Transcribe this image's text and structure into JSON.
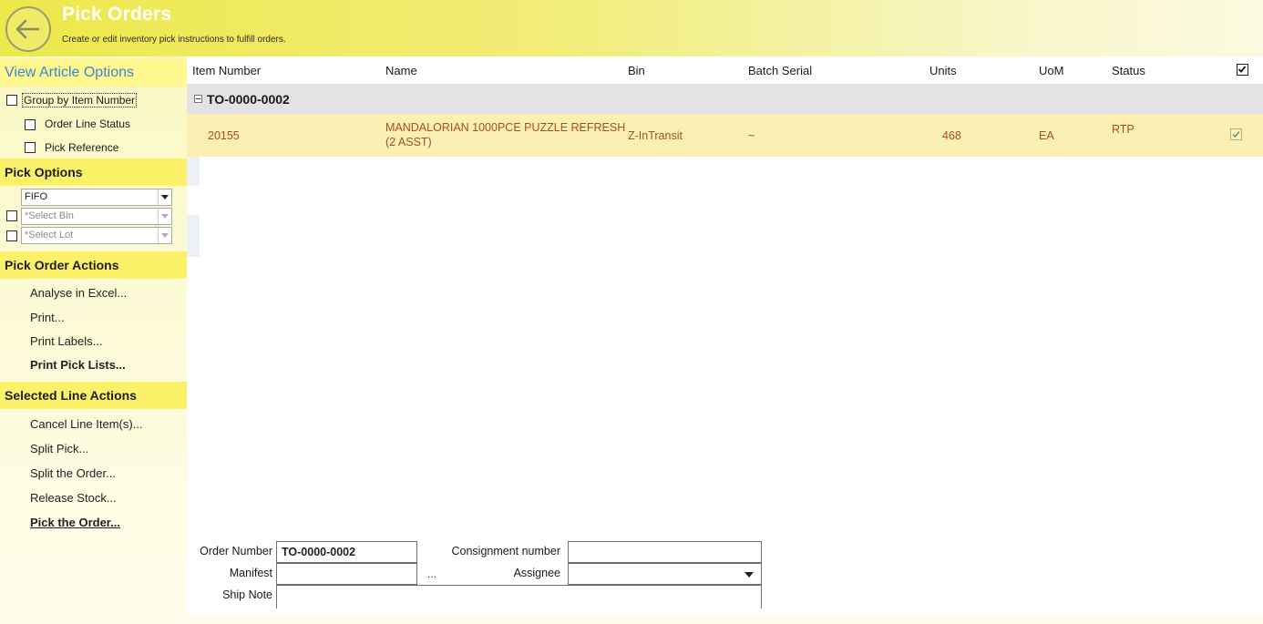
{
  "header": {
    "title": "Pick Orders",
    "subtitle": "Create or edit inventory pick instructions to fulfill orders."
  },
  "sidebar": {
    "view_options_title": "View Article Options",
    "group_by_item_number": "Group by Item Number",
    "order_line_status": "Order Line Status",
    "pick_reference": "Pick Reference",
    "pick_options_title": "Pick Options",
    "pick_method": "FIFO",
    "select_bin_placeholder": "*Select Bin",
    "select_lot_placeholder": "*Select Lot",
    "pick_order_actions_title": "Pick Order Actions",
    "pick_order_actions": [
      "Analyse in Excel...",
      "Print...",
      "Print Labels...",
      "Print Pick Lists..."
    ],
    "selected_line_actions_title": "Selected Line Actions",
    "selected_line_actions": [
      "Cancel Line Item(s)...",
      "Split Pick...",
      "Split the Order...",
      "Release Stock...",
      "Pick the Order..."
    ]
  },
  "grid": {
    "columns": [
      "Item Number",
      "Name",
      "Bin",
      "Batch Serial",
      "Units",
      "UoM",
      "Status"
    ],
    "group": "TO-0000-0002",
    "rows": [
      {
        "item_number": "20155",
        "name_line1": "MANDALORIAN 1000PCE PUZZLE REFRESH",
        "name_line2": "(2 ASST)",
        "bin": "Z-InTransit",
        "batch_serial": "~",
        "units": "468",
        "uom": "EA",
        "status": "RTP",
        "checked": true
      }
    ]
  },
  "form": {
    "order_number_label": "Order Number",
    "order_number": "TO-0000-0002",
    "consignment_label": "Consignment number",
    "consignment": "",
    "manifest_label": "Manifest",
    "manifest": "",
    "manifest_browse": "...",
    "assignee_label": "Assignee",
    "assignee": "",
    "ship_note_label": "Ship Note",
    "ship_note": ""
  }
}
